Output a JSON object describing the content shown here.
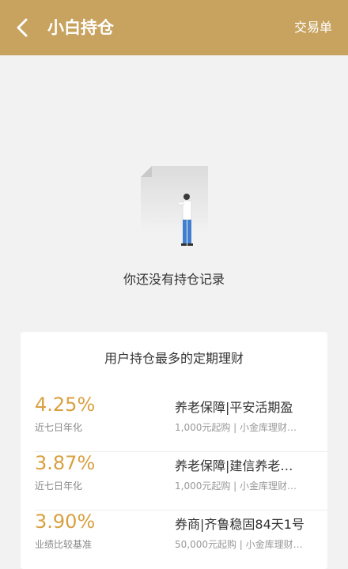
{
  "header": {
    "title": "小白持仓",
    "right_link": "交易单",
    "back_icon": "chevron-left-icon",
    "background": "#c8a360"
  },
  "empty_state": {
    "illustration_icon": "person-with-document-icon",
    "message": "你还没有持仓记录"
  },
  "recommend": {
    "title": "用户持仓最多的定期理财",
    "products": [
      {
        "rate": "4.25%",
        "rate_label": "近七日年化",
        "name": "养老保障|平安活期盈",
        "desc": "1,000元起购 | 小金库理财…"
      },
      {
        "rate": "3.87%",
        "rate_label": "近七日年化",
        "name": "养老保障|建信养老…",
        "desc": "1,000元起购 | 小金库理财…"
      },
      {
        "rate": "3.90%",
        "rate_label": "业绩比较基准",
        "name": "券商|齐鲁稳固84天1号",
        "desc": "50,000元起购 | 小金库理财…"
      }
    ]
  },
  "colors": {
    "accent": "#c8a360",
    "rate": "#d9a040",
    "background": "#f2f2f2"
  }
}
